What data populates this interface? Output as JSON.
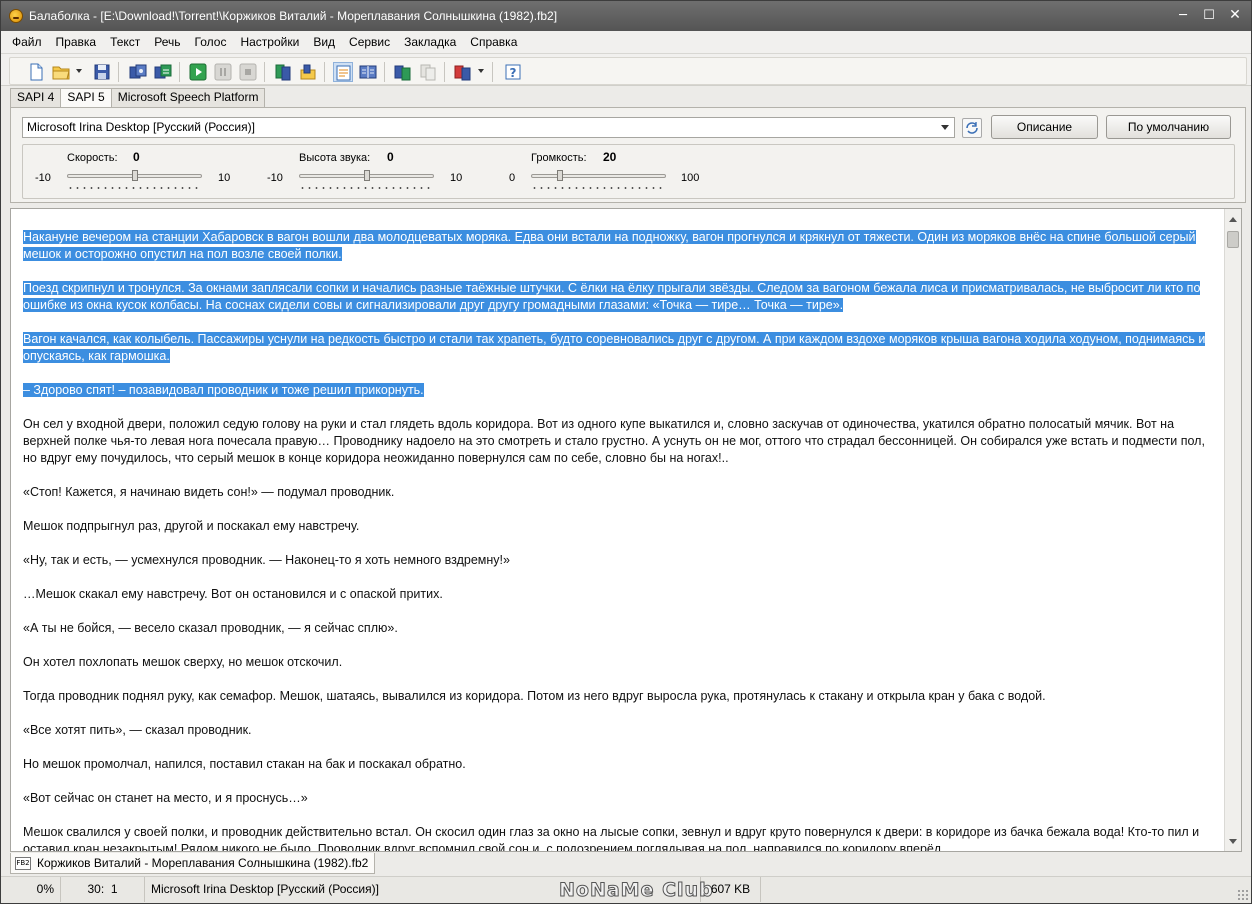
{
  "window": {
    "title": "Балаболка - [E:\\Download!\\Torrent!\\Коржиков Виталий - Мореплавания Солнышкина (1982).fb2]",
    "minimize": "─",
    "maximize": "☐",
    "close": "✕"
  },
  "menu": {
    "items": [
      "Файл",
      "Правка",
      "Текст",
      "Речь",
      "Голос",
      "Настройки",
      "Вид",
      "Сервис",
      "Закладка",
      "Справка"
    ]
  },
  "toolbar": {
    "icons": [
      "new-document-icon",
      "open-folder-icon",
      "save-icon",
      "save-audio-icon",
      "batch-convert-icon",
      "play-icon",
      "pause-icon",
      "stop-icon",
      "read-clipboard-icon",
      "spell-check-icon",
      "book-view-icon",
      "dictionary-icon",
      "compare-icon",
      "voice-settings-icon",
      "help-icon"
    ]
  },
  "tabs": {
    "items": [
      "SAPI 4",
      "SAPI 5",
      "Microsoft Speech Platform"
    ],
    "active": "SAPI 5"
  },
  "voice": {
    "selected": "Microsoft Irina Desktop [Русский (Россия)]",
    "description_button": "Описание",
    "default_button": "По умолчанию"
  },
  "sliders": {
    "speed": {
      "label": "Скорость:",
      "value": "0",
      "min": "-10",
      "max": "10",
      "level": 0.5
    },
    "pitch": {
      "label": "Высота звука:",
      "value": "0",
      "min": "-10",
      "max": "10",
      "level": 0.5
    },
    "volume": {
      "label": "Громкость:",
      "value": "20",
      "min": "0",
      "max": "100",
      "level": 0.2
    }
  },
  "document": {
    "paragraphs": [
      {
        "text": "Накануне вечером на станции Хабаровск в вагон вошли два молодцеватых моряка. Едва они встали на подножку, вагон прогнулся и крякнул от тяжести. Один из моряков внёс на спине большой серый мешок и осторожно опустил на пол возле своей полки.",
        "selected": true
      },
      {
        "text": "Поезд скрипнул и тронулся. За окнами заплясали сопки и начались разные таёжные штучки. С ёлки на ёлку прыгали звёзды. Следом за вагоном бежала лиса и присматривалась, не выбросит ли кто по ошибке из окна кусок колбасы. На соснах сидели совы и сигнализировали друг другу громадными глазами: «Точка — тире… Точка — тире».",
        "selected": true
      },
      {
        "text": "Вагон качался, как колыбель. Пассажиры уснули на редкость быстро и стали так храпеть, будто соревновались друг с другом. А при каждом вздохе моряков крыша вагона ходила ходуном, поднимаясь и опускаясь, как гармошка.",
        "selected": true
      },
      {
        "text": "– Здорово спят! – позавидовал проводник и тоже решил прикорнуть.",
        "selected": true
      },
      {
        "text": "Он сел у входной двери, положил седую голову на руки и стал глядеть вдоль коридора. Вот из одного купе выкатился и, словно заскучав от одиночества, укатился обратно полосатый мячик. Вот на верхней полке чья-то левая нога почесала правую… Проводнику надоело на это смотреть и стало грустно. А уснуть он не мог, оттого что страдал бессонницей. Он собирался уже встать и подмести пол, но вдруг ему почудилось, что серый мешок в конце коридора неожиданно повернулся сам по себе, словно бы на ногах!..",
        "selected": false
      },
      {
        "text": "«Стоп! Кажется, я начинаю видеть сон!» — подумал проводник.",
        "selected": false
      },
      {
        "text": "Мешок подпрыгнул раз, другой и поскакал ему навстречу.",
        "selected": false
      },
      {
        "text": "«Ну, так и есть, — усмехнулся проводник. — Наконец-то я хоть немного вздремну!»",
        "selected": false
      },
      {
        "text": "…Мешок скакал ему навстречу. Вот он остановился и с опаской притих.",
        "selected": false
      },
      {
        "text": "«А ты не бойся, — весело сказал проводник, — я сейчас сплю».",
        "selected": false
      },
      {
        "text": "Он хотел похлопать мешок сверху, но мешок отскочил.",
        "selected": false
      },
      {
        "text": "Тогда проводник поднял руку, как семафор. Мешок, шатаясь, вывалился из коридора. Потом из него вдруг выросла рука, протянулась к стакану и открыла кран у бака с водой.",
        "selected": false
      },
      {
        "text": "«Все хотят пить», — сказал проводник.",
        "selected": false
      },
      {
        "text": "Но мешок промолчал, напился, поставил стакан на бак и поскакал обратно.",
        "selected": false
      },
      {
        "text": "«Вот сейчас он станет на место, и я проснусь…»",
        "selected": false
      },
      {
        "text": "Мешок свалился у своей полки, и проводник действительно встал. Он скосил один глаз за окно на лысые сопки, зевнул и вдруг круто повернулся к двери: в коридоре из бачка бежала вода! Кто-то пил и оставил кран незакрытым! Рядом никого не было. Проводник вдруг вспомнил свой сон и, с подозрением поглядывая на пол, направился по коридору вперёд.",
        "selected": false
      }
    ]
  },
  "doc_tab": {
    "icon_label": "FB2",
    "label": "Коржиков Виталий - Мореплавания Солнышкина (1982).fb2"
  },
  "status": {
    "progress": "0%",
    "position": "30:  1",
    "voice": "Microsoft Irina Desktop [Русский (Россия)]",
    "watermark": "NoNaMe Club",
    "size": "607 KB"
  }
}
